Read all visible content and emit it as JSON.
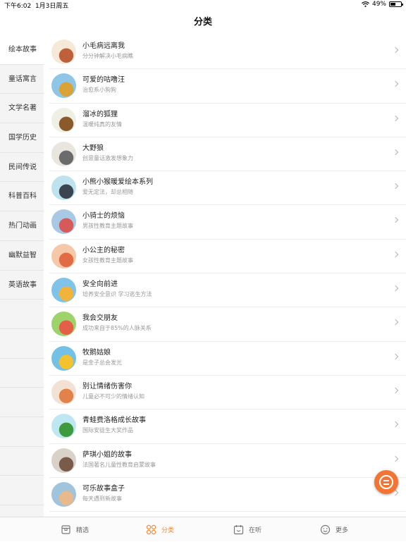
{
  "status_bar": {
    "time": "下午6:02",
    "date": "1月3日周五",
    "battery": "49%",
    "battery_level": 0.49
  },
  "header": {
    "title": "分类"
  },
  "sidebar": {
    "items": [
      {
        "label": "绘本故事",
        "active": true
      },
      {
        "label": "童话寓言",
        "active": false
      },
      {
        "label": "文学名著",
        "active": false
      },
      {
        "label": "国学历史",
        "active": false
      },
      {
        "label": "民间传说",
        "active": false
      },
      {
        "label": "科普百科",
        "active": false
      },
      {
        "label": "热门动画",
        "active": false
      },
      {
        "label": "幽默益智",
        "active": false
      },
      {
        "label": "英语故事",
        "active": false
      }
    ]
  },
  "list": {
    "items": [
      {
        "title": "小毛病远离我",
        "subtitle": "分分钟解决小毛病瞧",
        "colors": [
          "#f6e9d8",
          "#c0603a"
        ]
      },
      {
        "title": "可爱的咕噜汪",
        "subtitle": "治愈系小狗狗",
        "colors": [
          "#8fc6e8",
          "#d9a338"
        ]
      },
      {
        "title": "溜冰的狐狸",
        "subtitle": "温暖纯真的友情",
        "colors": [
          "#eef0e6",
          "#8a5a2b"
        ]
      },
      {
        "title": "大野狼",
        "subtitle": "创意童话激发想象力",
        "colors": [
          "#e8e6df",
          "#6b6b6b"
        ]
      },
      {
        "title": "小熊小猴暖爱绘本系列",
        "subtitle": "爱无定法，却总相随",
        "colors": [
          "#bfe3ee",
          "#3a4550"
        ]
      },
      {
        "title": "小骑士的烦恼",
        "subtitle": "男孩性教育主题故事",
        "colors": [
          "#a9c8e6",
          "#d65a5a"
        ]
      },
      {
        "title": "小公主的秘密",
        "subtitle": "女孩性教育主题故事",
        "colors": [
          "#f4c8a8",
          "#e06b44"
        ]
      },
      {
        "title": "安全向前进",
        "subtitle": "培养安全意识 学习逃生方法",
        "colors": [
          "#7fc3e8",
          "#f0b33b"
        ]
      },
      {
        "title": "我会交朋友",
        "subtitle": "成功来自于85%的人脉关系",
        "colors": [
          "#9ed26b",
          "#e35f48"
        ]
      },
      {
        "title": "牧鹅姑娘",
        "subtitle": "是金子总会发光",
        "colors": [
          "#74c1e6",
          "#f2c230"
        ]
      },
      {
        "title": "别让情绪伤害你",
        "subtitle": "儿童必不可少的情绪认知",
        "colors": [
          "#f3e2d4",
          "#e0824a"
        ]
      },
      {
        "title": "青蛙费洛格成长故事",
        "subtitle": "国际安徒生大奖作品",
        "colors": [
          "#bfe7f2",
          "#3f9a3f"
        ]
      },
      {
        "title": "萨琪小姐的故事",
        "subtitle": "法国著名儿童性教育启蒙故事",
        "colors": [
          "#d8d2c8",
          "#7a5a48"
        ]
      },
      {
        "title": "可乐故事盒子",
        "subtitle": "每天遇到新故事",
        "colors": [
          "#9fc4dc",
          "#e8b98a"
        ]
      }
    ]
  },
  "tab_bar": {
    "tabs": [
      {
        "label": "精选",
        "icon": "box-icon",
        "active": false
      },
      {
        "label": "分类",
        "icon": "grid-icon",
        "active": true
      },
      {
        "label": "在听",
        "icon": "calendar-icon",
        "active": false
      },
      {
        "label": "更多",
        "icon": "smile-icon",
        "active": false
      }
    ]
  },
  "floating_button": {
    "icon": "menu-circle-icon"
  },
  "colors": {
    "accent": "#f08a3c",
    "fab": "#f37533",
    "sidebar_bg": "#f4f4f4"
  }
}
